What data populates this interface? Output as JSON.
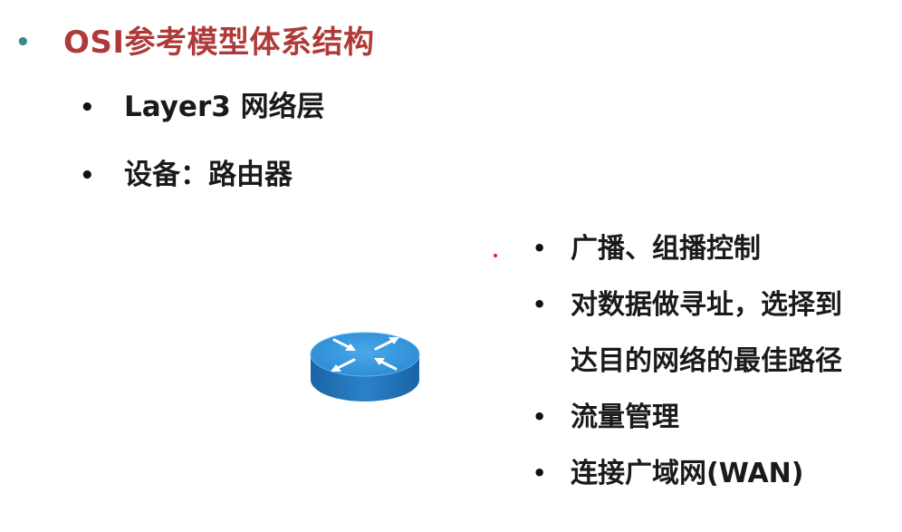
{
  "title": "OSI参考模型体系结构",
  "level2": [
    "Layer3 网络层",
    "设备：路由器"
  ],
  "right_list": {
    "item1": "广播、组播控制",
    "item2_line1": "对数据做寻址，选择到",
    "item2_line2": "达目的网络的最佳路径",
    "item3": "流量管理",
    "item4": "连接广域网(WAN)"
  },
  "bullet_char": "•",
  "colors": {
    "title": "#b03a3a",
    "title_bullet": "#3a8a8a",
    "router_top": "#2f8fd6",
    "router_side": "#1a6fb3"
  },
  "icons": {
    "router": "router-icon"
  }
}
